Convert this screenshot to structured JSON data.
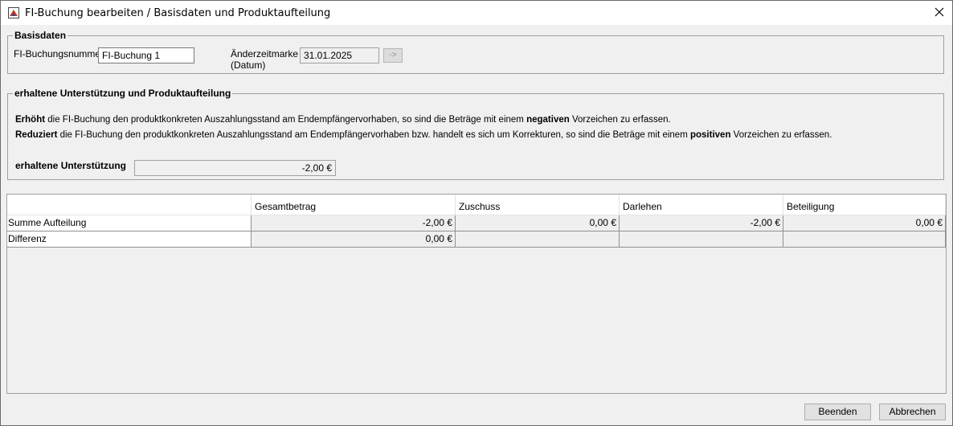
{
  "window": {
    "title": "FI-Buchung bearbeiten / Basisdaten und Produktaufteilung",
    "icon": "app-icon",
    "close_icon": "close-icon"
  },
  "basisdaten": {
    "legend": "Basisdaten",
    "nummer_label": "FI-Buchungsnummer",
    "nummer_value": "FI-Buchung 1",
    "aenderung_label_1": "Änderzeitmarke",
    "aenderung_label_2": "(Datum)",
    "aenderung_value": "31.01.2025",
    "arrow_button": "->"
  },
  "unterstuetzung": {
    "legend": "erhaltene Unterstützung und Produktaufteilung",
    "line1_bold": "Erhöht",
    "line1_a": " die FI-Buchung den produktkonkreten Auszahlungsstand am Endempfängervorhaben, so sind die Beträge mit einem ",
    "line1_bold2": "negativen",
    "line1_b": " Vorzeichen zu erfassen.",
    "line2_bold": "Reduziert",
    "line2_a": " die FI-Buchung den produktkonkreten Auszahlungsstand am Endempfängervorhaben bzw. handelt es sich um Korrekturen, so sind die Beträge mit einem ",
    "line2_bold2": "positiven",
    "line2_b": " Vorzeichen zu erfassen.",
    "support_label": "erhaltene Unterstützung",
    "support_value": "-2,00 €"
  },
  "table": {
    "headers": [
      "",
      "Gesamtbetrag",
      "Zuschuss",
      "Darlehen",
      "Beteiligung"
    ],
    "rows": [
      {
        "label": "Summe Aufteilung",
        "cells": [
          "-2,00 €",
          "0,00 €",
          "-2,00 €",
          "0,00 €"
        ]
      },
      {
        "label": "Differenz",
        "cells": [
          "0,00 €",
          "",
          "",
          ""
        ]
      }
    ]
  },
  "buttons": {
    "beenden": "Beenden",
    "abbrechen": "Abbrechen"
  }
}
